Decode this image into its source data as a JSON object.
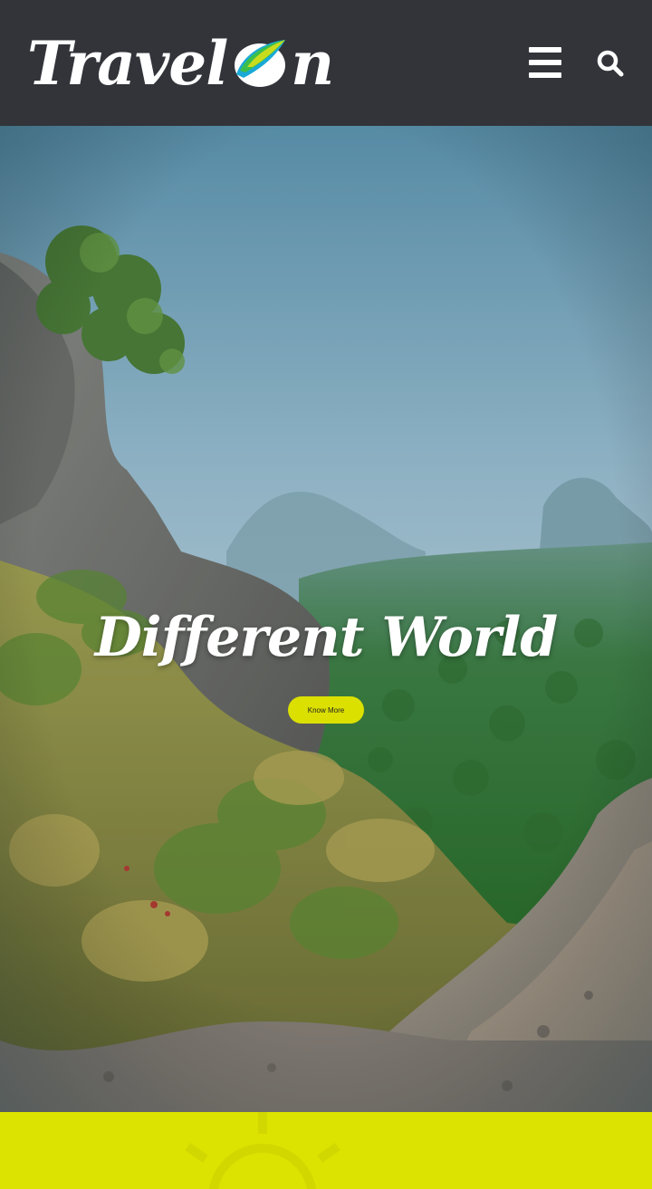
{
  "header": {
    "logo": {
      "text": "Travel",
      "suffix": "n",
      "mark_icon": "leaf-o-logo-icon"
    },
    "menu_icon": "hamburger-menu-icon",
    "search_icon": "search-icon",
    "background_color": "#32343a"
  },
  "hero": {
    "title": "Different World",
    "cta_label": "Know More",
    "accent_color": "#dbe000"
  },
  "bottom": {
    "watermark_icon": "sun-icon",
    "background_color": "#dde300"
  }
}
